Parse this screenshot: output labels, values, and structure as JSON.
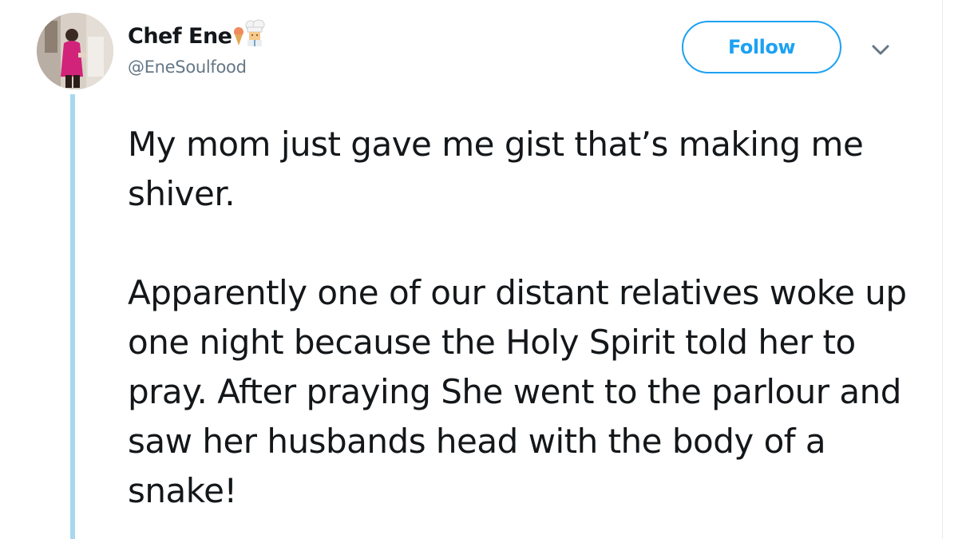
{
  "user": {
    "display_name": "Chef Ene",
    "handle": "@EneSoulfood",
    "name_emojis": [
      "ice-cream-icon",
      "chef-icon"
    ]
  },
  "actions": {
    "follow_label": "Follow",
    "more_icon": "chevron-down-icon"
  },
  "tweet": {
    "paragraphs": [
      "My mom just gave me gist that’s making me shiver.",
      "Apparently one of our distant relatives woke up one night because the Holy Spirit told her to pray. After praying She went to the parlour and saw her husbands head with the body of a snake!"
    ]
  },
  "colors": {
    "accent": "#1da1f2",
    "thread_line": "#a7d8f0",
    "text": "#14171a",
    "secondary_text": "#657786"
  }
}
